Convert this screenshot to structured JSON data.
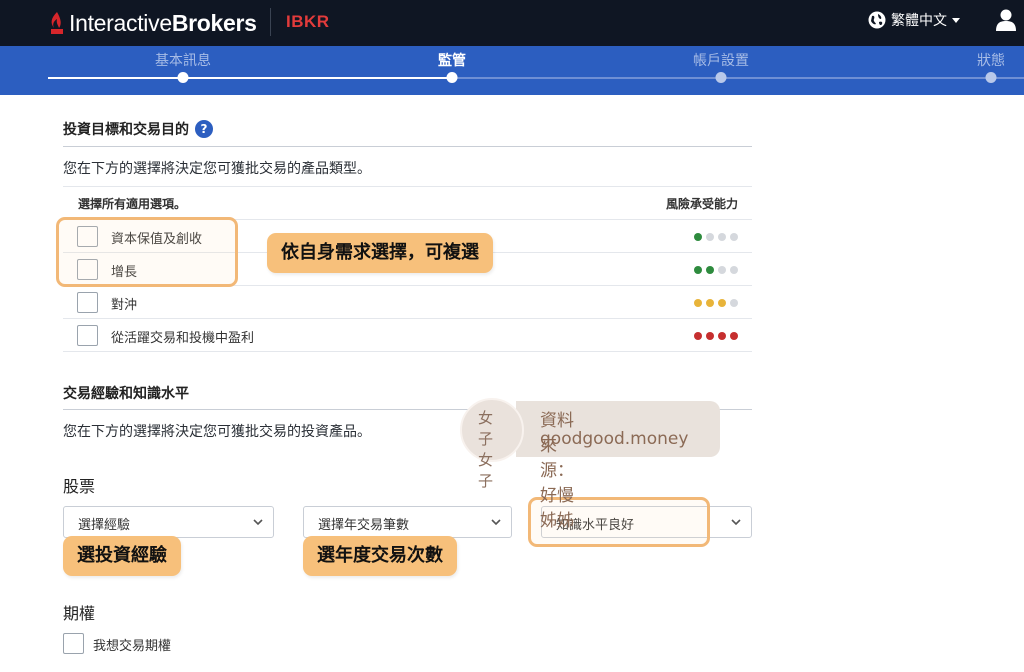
{
  "brand": {
    "logo_text_1": "Interactive",
    "logo_text_2": "Brokers",
    "product": "IBKR"
  },
  "header": {
    "language": "繁體中文"
  },
  "steps": [
    {
      "label": "基本訊息",
      "state": "done"
    },
    {
      "label": "監管",
      "state": "active"
    },
    {
      "label": "帳戶設置",
      "state": "todo"
    },
    {
      "label": "狀態",
      "state": "todo"
    }
  ],
  "objectives": {
    "title": "投資目標和交易目的",
    "help": "?",
    "description": "您在下方的選擇將決定您可獲批交易的產品類型。",
    "col_select": "選擇所有適用選項。",
    "col_risk": "風險承受能力",
    "options": [
      {
        "label": "資本保值及創收",
        "risk": 1,
        "color": "#2e8b3e"
      },
      {
        "label": "增長",
        "risk": 2,
        "color": "#2e8b3e"
      },
      {
        "label": "對沖",
        "risk": 3,
        "color": "#e8b43a"
      },
      {
        "label": "從活躍交易和投機中盈利",
        "risk": 4,
        "color": "#c62f2f"
      }
    ],
    "inactive_dot_color": "#d5d8dd"
  },
  "experience": {
    "title": "交易經驗和知識水平",
    "description": "您在下方的選擇將決定您可獲批交易的投資產品。",
    "stocks": {
      "title": "股票",
      "experience_select": "選擇經驗",
      "trades_select": "選擇年交易筆數",
      "knowledge_select": "知識水平良好"
    },
    "options": {
      "title": "期權",
      "checkbox_label": "我想交易期權"
    }
  },
  "annotations": {
    "multi_select": "依自身需求選擇，可複選",
    "pick_experience": "選投資經驗",
    "pick_trades": "選年度交易次數"
  },
  "watermark": {
    "mark": "女子女子",
    "mark_line1": "女子",
    "mark_line2": "女子",
    "source": "資料來源：好慢姊姊",
    "site": "goodgood.money"
  }
}
